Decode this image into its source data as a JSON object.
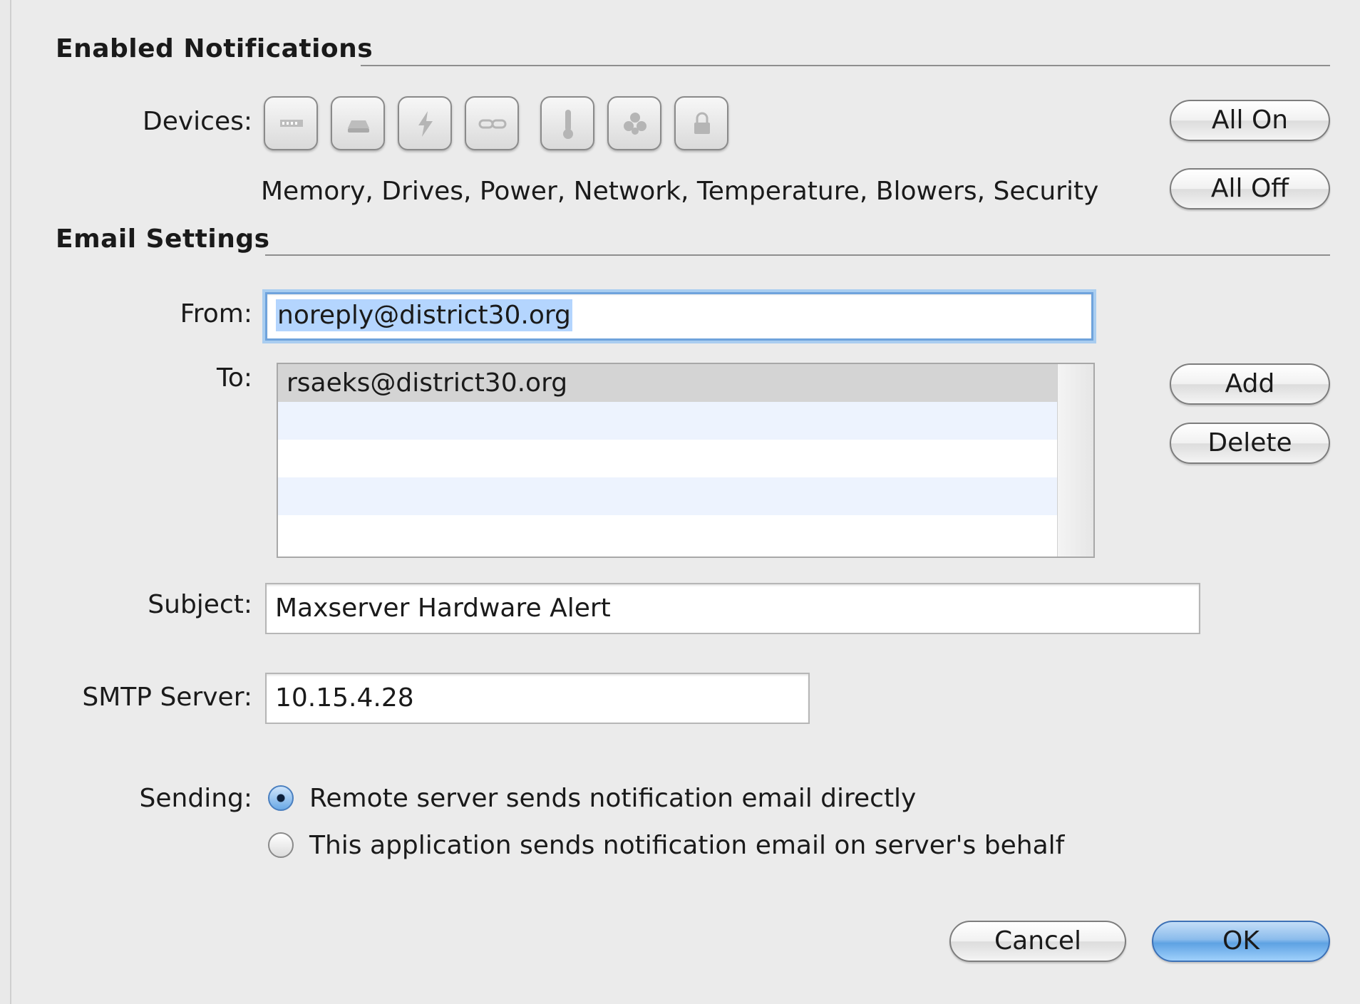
{
  "notifications": {
    "title": "Enabled Notifications",
    "devices_label": "Devices:",
    "devices_list": "Memory, Drives, Power, Network, Temperature, Blowers, Security",
    "device_icons": [
      "memory-icon",
      "drive-icon",
      "power-icon",
      "network-icon",
      "temperature-icon",
      "blower-icon",
      "security-icon"
    ],
    "all_on": "All On",
    "all_off": "All Off"
  },
  "email": {
    "title": "Email Settings",
    "from_label": "From:",
    "from_value": "noreply@district30.org",
    "to_label": "To:",
    "to_list": [
      "rsaeks@district30.org"
    ],
    "add": "Add",
    "delete": "Delete",
    "subject_label": "Subject:",
    "subject_value": "Maxserver Hardware Alert",
    "smtp_label": "SMTP Server:",
    "smtp_value": "10.15.4.28",
    "sending_label": "Sending:",
    "sending_options": [
      {
        "label": "Remote server sends notification email directly",
        "selected": true
      },
      {
        "label": "This application sends notification email on server's behalf",
        "selected": false
      }
    ]
  },
  "footer": {
    "cancel": "Cancel",
    "ok": "OK"
  }
}
